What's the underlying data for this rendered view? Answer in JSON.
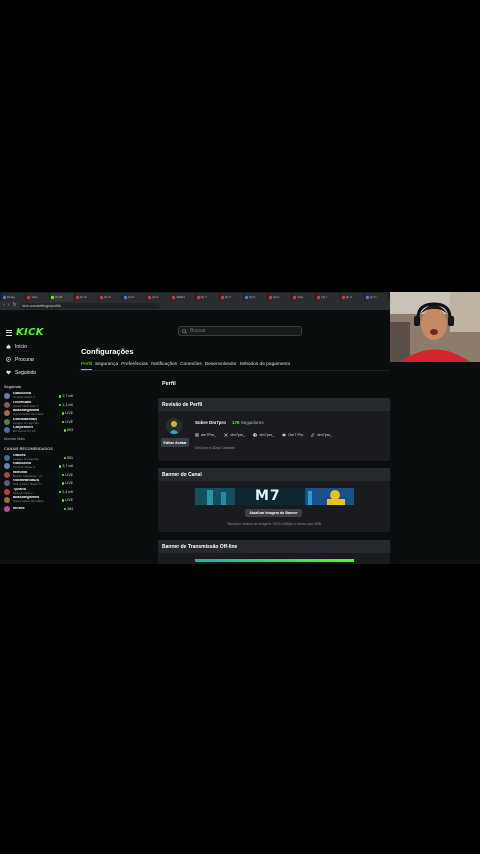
{
  "browser": {
    "tabs": [
      {
        "label": "Desig",
        "active": false
      },
      {
        "label": "Joao",
        "active": false
      },
      {
        "label": "Perfil",
        "active": true
      },
      {
        "label": "(2) Ki",
        "active": false
      },
      {
        "label": "(2) Ki",
        "active": false
      },
      {
        "label": "(2) K",
        "active": false
      },
      {
        "label": "(2) K",
        "active": false
      },
      {
        "label": "AREN",
        "active": false
      },
      {
        "label": "(2) Y",
        "active": false
      },
      {
        "label": "(2) T",
        "active": false
      },
      {
        "label": "(2) K",
        "active": false
      },
      {
        "label": "(2) A",
        "active": false
      },
      {
        "label": "Clas",
        "active": false
      },
      {
        "label": "(2) I",
        "active": false
      },
      {
        "label": "(2) A",
        "active": false
      },
      {
        "label": "(2) C",
        "active": false
      }
    ],
    "url": "kick.com/settings/profile"
  },
  "header": {
    "logo": "KICK",
    "search_placeholder": "Buscar"
  },
  "sidebar": {
    "nav": [
      {
        "label": "Início",
        "icon": "home-icon"
      },
      {
        "label": "Procurar",
        "icon": "compass-icon"
      },
      {
        "label": "Seguindo",
        "icon": "heart-icon"
      }
    ],
    "following_title": "Seguindo",
    "following": [
      {
        "name": "GabiiDoto",
        "game": "Counter-Strike 2",
        "viewers": "2,7 mil",
        "avatar_color": "#6b7fa8"
      },
      {
        "name": "OSoHuani",
        "game": "Grand Theft Auto V",
        "viewers": "1,3 mil",
        "avatar_color": "#8a5a4a"
      },
      {
        "name": "abacategames",
        "game": "Supermarket Simulator",
        "viewers": "LIVE",
        "avatar_color": "#a36e3a"
      },
      {
        "name": "Dontalacidan",
        "game": "League of Legends",
        "viewers": "LIVE",
        "avatar_color": "#5a7a5a"
      },
      {
        "name": "Carpentieri",
        "game": "EA Sports FC 25",
        "viewers": "693",
        "avatar_color": "#4d6d9d"
      }
    ],
    "show_more": "Mostrar Mais",
    "recommended_title": "CANAIS RECOMENDADOS",
    "recommended": [
      {
        "name": "Gaules",
        "game": "League of Legends",
        "viewers": "551",
        "avatar_color": "#3c6e9c"
      },
      {
        "name": "GabiiDoto",
        "game": "Counter-Strike 2",
        "viewers": "2,7 mil",
        "avatar_color": "#6b7fa8"
      },
      {
        "name": "vBrunio",
        "game": "Naruto Shippuden: Ul...",
        "viewers": "LIVE",
        "avatar_color": "#9a4a4a"
      },
      {
        "name": "GoiMirandaDS",
        "game": "Call of Duty: Black O...",
        "viewers": "LIVE",
        "avatar_color": "#5a5a8a"
      },
      {
        "name": "Tycano",
        "game": "Slots & Casino",
        "viewers": "1,4 mil",
        "avatar_color": "#c03a3a"
      },
      {
        "name": "abacategames",
        "game": "Supermarket Simulator",
        "viewers": "LIVE",
        "avatar_color": "#a36e3a"
      },
      {
        "name": "tenros",
        "game": "",
        "viewers": "384",
        "avatar_color": "#c04a9a"
      }
    ]
  },
  "main": {
    "title": "Configurações",
    "tabs": [
      "Perfil",
      "Segurança",
      "Preferências",
      "Notificações",
      "Conexões",
      "Desenvolvedor",
      "Métodos de pagamento"
    ],
    "active_tab": "Perfil",
    "section_heading": "Perfil",
    "review": {
      "title": "Revisão de Perfil",
      "about": "Sobre Dm7pro",
      "followers_count": "176",
      "followers_label": "Seguidores",
      "edit_avatar": "Editar Avatar",
      "socials": [
        {
          "icon": "instagram-icon",
          "handle": "dm7Pro_"
        },
        {
          "icon": "x-icon",
          "handle": "dm7pro_"
        },
        {
          "icon": "facebook-icon",
          "handle": "dm7pro_"
        },
        {
          "icon": "discord-icon",
          "handle": "Dm7 Pro"
        },
        {
          "icon": "tiktok-icon",
          "handle": "dm7pro_"
        }
      ],
      "bio": "Dm7pro e ADuz Channel"
    },
    "banner": {
      "title": "Banner do Canal",
      "banner_text": "M7",
      "button": "Atualizar Imagem do Banner",
      "hint": "Tamanho mínimo de imagem: 1920×1080px e menor que 4MB"
    },
    "offline": {
      "title": "Banner de Transmissão Off-line"
    }
  },
  "colors": {
    "brand": "#53fc18",
    "background": "#0b0e0f",
    "card": "#191b1f"
  }
}
